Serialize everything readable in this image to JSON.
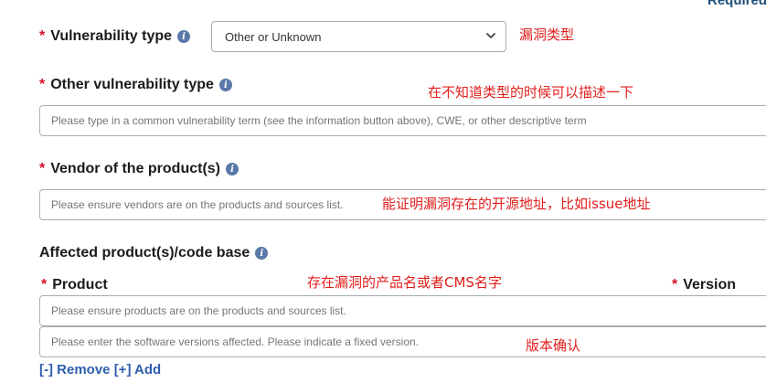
{
  "header": {
    "required_text": "Required"
  },
  "vulnerability_type": {
    "label": "Vulnerability type",
    "selected": "Other or Unknown",
    "note": "漏洞类型"
  },
  "other_vulnerability_type": {
    "label": "Other vulnerability type",
    "placeholder": "Please type in a common vulnerability term (see the information button above), CWE, or other descriptive term",
    "note": "在不知道类型的时候可以描述一下"
  },
  "vendor": {
    "label": "Vendor of the product(s)",
    "placeholder": "Please ensure vendors are on the products and sources list.",
    "note": "能证明漏洞存在的开源地址，比如issue地址"
  },
  "affected": {
    "section_label": "Affected product(s)/code base",
    "product_label": "Product",
    "version_label": "Version",
    "product_placeholder": "Please ensure products are on the products and sources list.",
    "version_placeholder": "Please enter the software versions affected. Please indicate a fixed version.",
    "product_note": "存在漏洞的产品名或者CMS名字",
    "version_note": "版本确认",
    "remove_label": "[-] Remove",
    "add_label": "[+] Add"
  },
  "colors": {
    "required_star": "#d6112b",
    "annotation": "#e0201d",
    "link": "#2f5faf",
    "info_icon": "#5a79a8"
  },
  "icons": {
    "info": "info-icon",
    "dropdown": "chevron-down-icon"
  }
}
